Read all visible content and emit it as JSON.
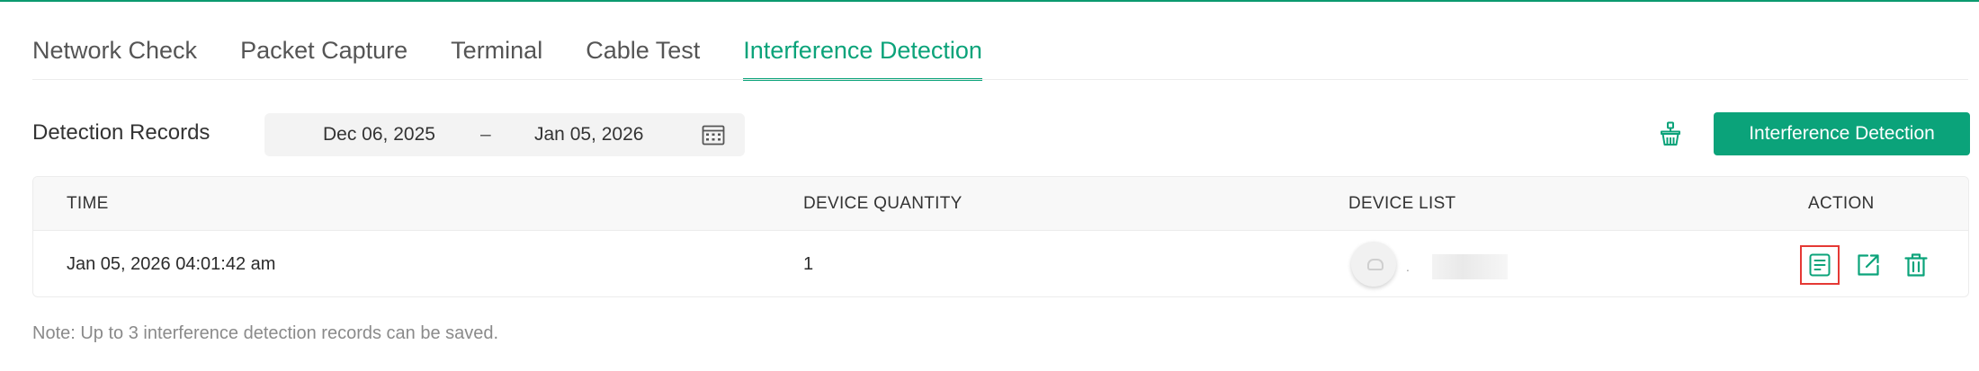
{
  "tabs": [
    {
      "label": "Network Check",
      "active": false
    },
    {
      "label": "Packet Capture",
      "active": false
    },
    {
      "label": "Terminal",
      "active": false
    },
    {
      "label": "Cable Test",
      "active": false
    },
    {
      "label": "Interference Detection",
      "active": true
    }
  ],
  "toolbar": {
    "title": "Detection Records",
    "date_start": "Dec 06, 2025",
    "date_separator": "–",
    "date_end": "Jan 05, 2026",
    "primary_button_label": "Interference Detection"
  },
  "table": {
    "columns": [
      "TIME",
      "DEVICE QUANTITY",
      "DEVICE LIST",
      "ACTION"
    ],
    "rows": [
      {
        "time": "Jan 05, 2026 04:01:42 am",
        "device_quantity": "1",
        "device_separator": "."
      }
    ]
  },
  "note": "Note: Up to 3 interference detection records can be saved.",
  "colors": {
    "accent": "#0ba37a",
    "highlight_border": "#e53935"
  },
  "icons": {
    "calendar": "calendar-icon",
    "clean": "clean-records-icon",
    "view": "view-details-icon",
    "export": "export-icon",
    "delete": "trash-icon"
  }
}
